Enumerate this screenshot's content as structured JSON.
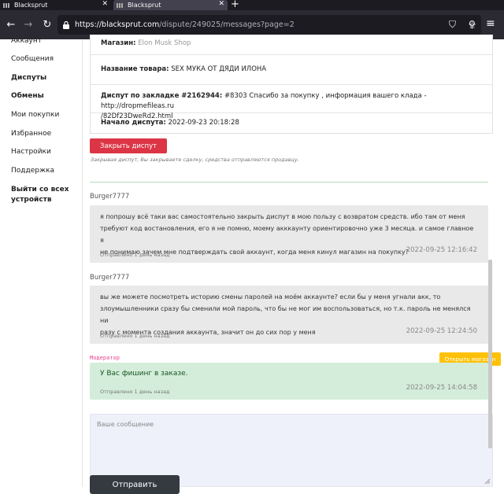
{
  "browser": {
    "tabs": [
      {
        "label": "Blacksprut",
        "active": false
      },
      {
        "label": "Blacksprut",
        "active": true
      }
    ],
    "url_host": "https://blacksprut.com",
    "url_path": "/dispute/249025/messages?page=2"
  },
  "sidebar": {
    "items": [
      {
        "label": "Аккаунт",
        "bold": false
      },
      {
        "label": "Сообщения",
        "bold": false
      },
      {
        "label": "Диспуты",
        "bold": true
      },
      {
        "label": "Обмены",
        "bold": true
      },
      {
        "label": "Мои покупки",
        "bold": false
      },
      {
        "label": "Избранное",
        "bold": false
      },
      {
        "label": "Настройки",
        "bold": false
      },
      {
        "label": "Поддержка",
        "bold": false
      },
      {
        "label": "Выйти со всех",
        "bold": true
      },
      {
        "label": "устройств",
        "bold": true
      }
    ]
  },
  "dispute": {
    "shop_label": "Магазин:",
    "shop_value": "Elon Musk Shop",
    "product_label": "Название товара:",
    "product_value": "SEX МУКА ОТ ДЯДИ ИЛОНА",
    "bookmark_label": "Диспут по закладке #2162944:",
    "bookmark_value_1": "#8303 Спасибо за покупку , информация вашего клада - http://dropmefileas.ru",
    "bookmark_value_2": "/82Df23DweRd2.html",
    "start_label": "Начало диспута:",
    "start_value": "2022-09-23 20:18:28",
    "close_button": "Закрыть диспут",
    "close_hint": "Закрывая диспут, Вы закрываете сделку, средства отправляются продавцу."
  },
  "messages": [
    {
      "author": "Burger7777",
      "lines": [
        "я попрошу всё таки вас самостоятельно закрыть диспут в мою пользу с возвратом средств. ибо там от меня",
        "требуют код востановления, его я не помню, моему акккаунту ориентировочно уже 3 месяца. и самое главное я",
        "не понимаю зачем мне подтверждать свой аккаунт, когда меня кинул магазин на покупку?"
      ],
      "sent": "Отправлено 1 день назад",
      "date": "2022-09-25 12:16:42"
    },
    {
      "author": "Burger7777",
      "lines": [
        "вы же можете посмотреть историю смены паролей на моём аккаунте? если бы у меня угнали акк, то",
        "злоумышленники сразу бы сменили мой пароль, что бы не мог им воспользоваться, но т.к. пароль не менялся ни",
        "разу с момента создания аккаунта, значит он до сих пор у меня"
      ],
      "sent": "Отправлено 1 день назад",
      "date": "2022-09-25 12:24:50"
    },
    {
      "author": "Модератор",
      "lines": [
        "У Вас фишинг в заказе."
      ],
      "sent": "Отправлено 1 день назад",
      "date": "2022-09-25 14:04:58"
    }
  ],
  "open_shop_button": "Открыть магазин",
  "reply": {
    "placeholder": "Ваше сообщение",
    "send_button": "Отправить"
  },
  "colors": {
    "danger": "#dc3545",
    "warning": "#ffc107",
    "moderator_bg": "#d4edda",
    "moderator_label": "#e83e8c"
  }
}
